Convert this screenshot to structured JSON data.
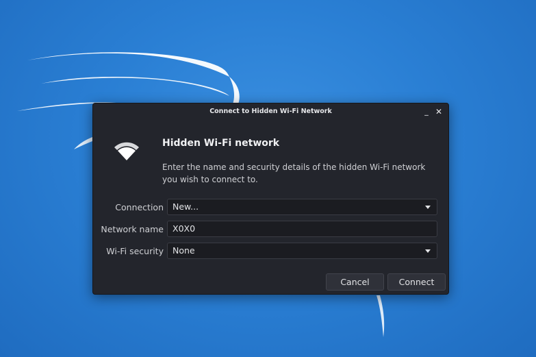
{
  "dialog": {
    "title": "Connect to Hidden Wi-Fi Network",
    "minimize_label": "_",
    "close_label": "✕",
    "heading": "Hidden Wi-Fi network",
    "description": "Enter the name and security details of the hidden Wi-Fi network you wish to connect to.",
    "icon": "wifi-icon"
  },
  "form": {
    "connection": {
      "label": "Connection",
      "value": "New..."
    },
    "network_name": {
      "label": "Network name",
      "value": "X0X0"
    },
    "wifi_security": {
      "label": "Wi-Fi security",
      "value": "None"
    }
  },
  "buttons": {
    "cancel": "Cancel",
    "connect": "Connect"
  },
  "colors": {
    "dialog_bg": "#23252c",
    "field_bg": "#1b1c21",
    "desktop_bg": "#2a7fd4"
  }
}
